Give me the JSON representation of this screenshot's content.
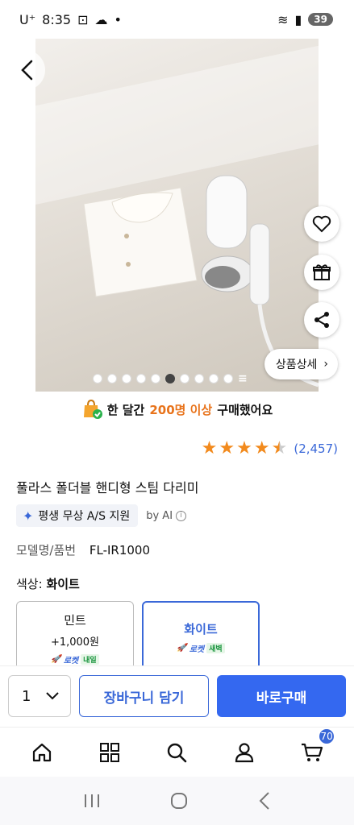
{
  "status_bar": {
    "carrier": "U⁺",
    "time": "8:35",
    "battery": "39"
  },
  "product_image": {
    "dot_count": 10,
    "active_index": 5
  },
  "detail_button": {
    "label": "상품상세"
  },
  "sold_banner": {
    "prefix": "한 달간",
    "highlight": "200명 이상",
    "suffix": "구매했어요"
  },
  "rating": {
    "stars": 4.5,
    "review_count": "(2,457)",
    "color": "#f28a1d"
  },
  "product": {
    "title": "풀라스 폴더블 핸디형 스팀 다리미",
    "ai_badge": "평생 무상 A/S 지원",
    "by_ai": "by AI",
    "model_key": "모델명/품번",
    "model_value": "FL-IR1000"
  },
  "color_option": {
    "label_key": "색상:",
    "label_value": "화이트",
    "options": [
      {
        "name": "민트",
        "price": "+1,000원",
        "rocket": "로켓",
        "delivery": "내일"
      },
      {
        "name": "화이트",
        "price": "",
        "rocket": "로켓",
        "delivery": "새벽"
      }
    ]
  },
  "buy_bar": {
    "quantity": "1",
    "cart_label": "장바구니 담기",
    "buy_label": "바로구매",
    "accent": "#3468f0"
  },
  "bottom_nav": {
    "cart_badge": "70",
    "items": [
      "home-icon",
      "category-icon",
      "search-icon",
      "profile-icon",
      "cart-icon"
    ]
  }
}
